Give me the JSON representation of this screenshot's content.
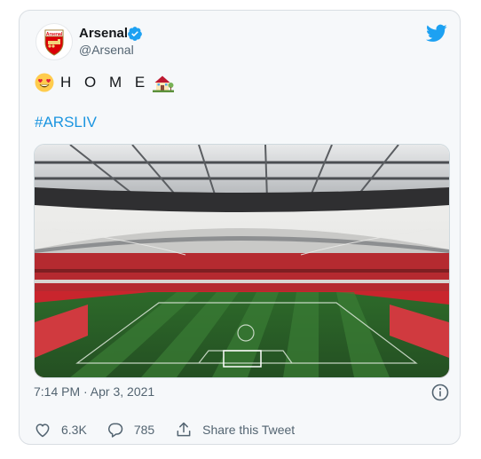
{
  "author": {
    "display_name": "Arsenal",
    "handle": "@Arsenal",
    "crest_text": "Arsenal",
    "verified": true,
    "avatar_icon": "arsenal-crest-icon"
  },
  "tweet": {
    "text": "H O M E",
    "leading_emoji": "smiling-face-with-heart-eyes-icon",
    "trailing_emoji": "house-with-garden-icon",
    "hashtag": "#ARSLIV",
    "timestamp": "7:14 PM · Apr 3, 2021"
  },
  "actions": {
    "likes": "6.3K",
    "replies": "785",
    "share_label": "Share this Tweet"
  },
  "colors": {
    "brand_blue": "#1da1f2",
    "link_blue": "#1b95e0",
    "muted_text": "#536471",
    "card_bg": "#f6f8fa",
    "arsenal_red": "#db0007"
  }
}
